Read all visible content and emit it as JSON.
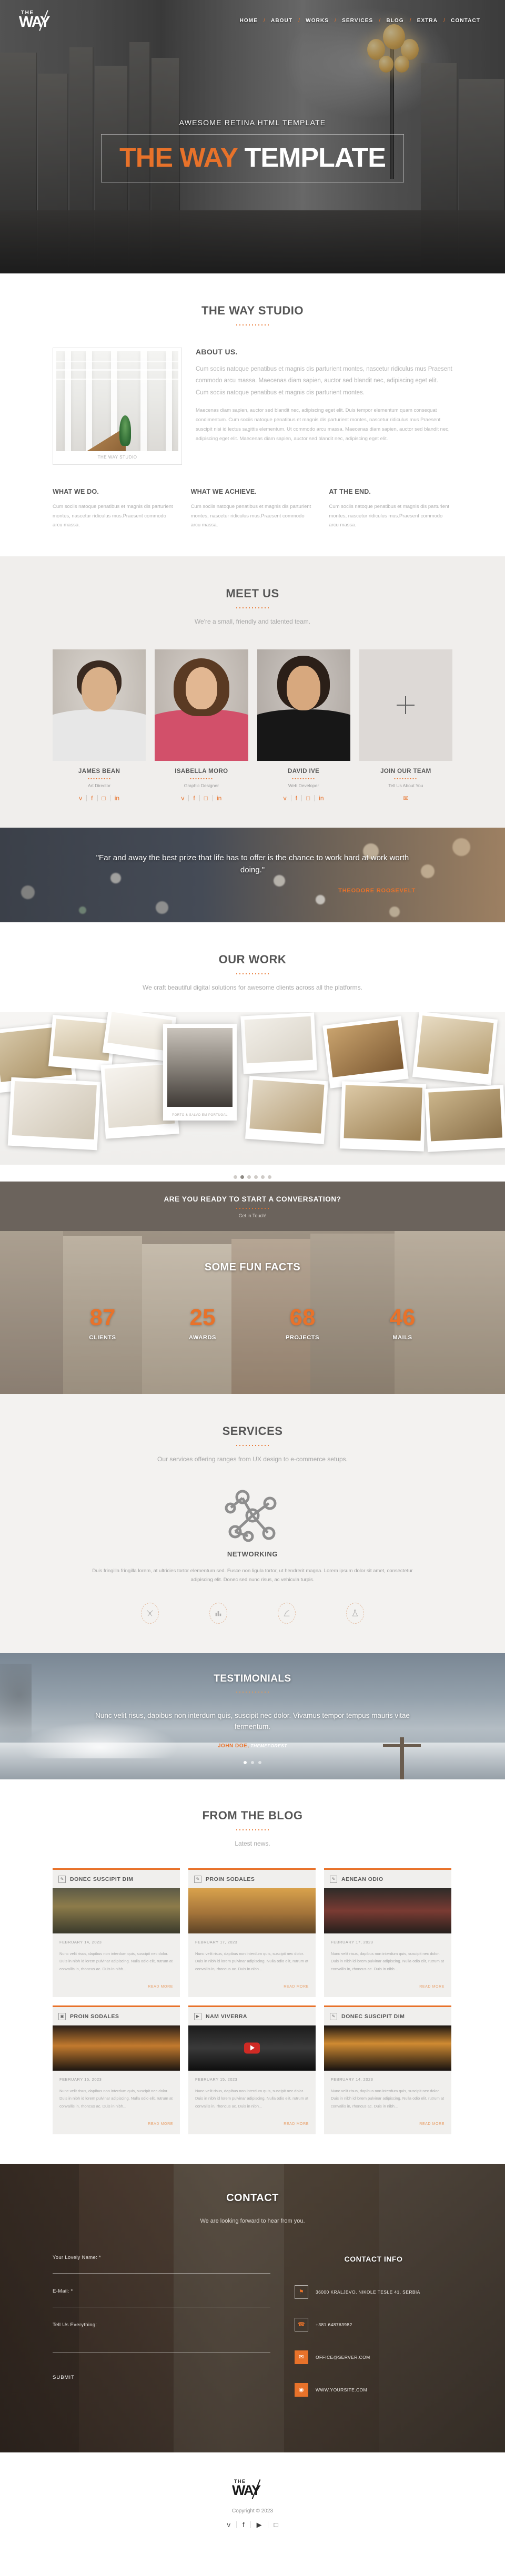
{
  "brand": {
    "the": "THE",
    "way": "WAY"
  },
  "nav": {
    "items": [
      "HOME",
      "ABOUT",
      "WORKS",
      "SERVICES",
      "BLOG",
      "EXTRA",
      "CONTACT"
    ],
    "separator": "/"
  },
  "hero": {
    "subtitle": "AWESOME RETINA HTML TEMPLATE",
    "title_orange": "THE WAY",
    "title_white": "TEMPLATE"
  },
  "studio": {
    "title": "THE WAY STUDIO",
    "about_heading": "ABOUT US.",
    "about_p1": "Cum sociis natoque penatibus et magnis dis parturient montes, nascetur ridiculus mus Praesent commodo arcu massa. Maecenas diam sapien, auctor sed blandit nec, adipiscing eget elit. Cum sociis natoque penatibus et magnis dis parturient montes.",
    "about_p2": "Maecenas diam sapien, auctor sed blandit nec, adipiscing eget elit. Duis tempor elementum quam consequat condimentum. Cum sociis natoque penatibus et magnis dis parturient montes, nascetur ridiculus mus Praesent suscipit nisi id lectus sagittis elementum. Ut commodo arcu massa. Maecenas diam sapien, auctor sed blandit nec, adipiscing eget elit. Maecenas diam sapien, auctor sed blandit nec, adipiscing eget elit.",
    "image_caption": "THE WAY STUDIO",
    "columns": [
      {
        "heading": "WHAT WE DO.",
        "text": "Cum sociis natoque penatibus et magnis dis parturient montes, nascetur ridiculus mus.Praesent commodo arcu massa."
      },
      {
        "heading": "WHAT WE ACHIEVE.",
        "text": "Cum sociis natoque penatibus et magnis dis parturient montes, nascetur ridiculus mus.Praesent commodo arcu massa."
      },
      {
        "heading": "AT THE END.",
        "text": "Cum sociis natoque penatibus et magnis dis parturient montes, nascetur ridiculus mus.Praesent commodo arcu massa."
      }
    ]
  },
  "team": {
    "title": "MEET US",
    "subtitle": "We're a small, friendly and talented team.",
    "members": [
      {
        "name": "JAMES BEAN",
        "role": "Art Director"
      },
      {
        "name": "ISABELLA MORO",
        "role": "Graphic Designer"
      },
      {
        "name": "DAVID IVE",
        "role": "Web Developer"
      },
      {
        "name": "JOIN OUR TEAM",
        "role": "Tell Us About You"
      }
    ],
    "social_icons": [
      "twitter-icon",
      "facebook-icon",
      "instagram-icon",
      "linkedin-icon"
    ],
    "social_glyphs": [
      "ᴠ",
      "f",
      "□",
      "in"
    ],
    "join_icon": "envelope-icon"
  },
  "quote": {
    "text": "\"Far and away the best prize that life has to offer is the chance to work hard at work worth doing.\"",
    "author": "THEODORE ROOSEVELT"
  },
  "work": {
    "title": "OUR WORK",
    "subtitle": "We craft beautiful digital solutions for awesome clients across all the platforms.",
    "featured_caption": "PORTO & SALVO EM PORTUGAL",
    "pager_count": 6,
    "pager_active": 1
  },
  "cta": {
    "heading": "ARE YOU READY TO START A CONVERSATION?",
    "sub": "Get in Touch!"
  },
  "facts": {
    "title": "SOME FUN FACTS",
    "items": [
      {
        "value": "87",
        "label": "CLIENTS"
      },
      {
        "value": "25",
        "label": "AWARDS"
      },
      {
        "value": "68",
        "label": "PROJECTS"
      },
      {
        "value": "46",
        "label": "MAILS"
      }
    ]
  },
  "services": {
    "title": "SERVICES",
    "subtitle": "Our services offering ranges from UX design to e-commerce setups.",
    "main_icon": "network-nodes-icon",
    "main_heading": "NETWORKING",
    "main_text": "Duis fringilla fringilla lorem, at ultricies tortor elementum sed. Fusce non ligula tortor, ut hendrerit magna. Lorem ipsum dolor sit amet, consectetur adipiscing elit. Donec sed nunc risus, ac vehicula turpis.",
    "icons": [
      "tools-icon",
      "bar-chart-icon",
      "pen-nib-icon",
      "flask-icon"
    ]
  },
  "testimonials": {
    "title": "TESTIMONIALS",
    "quote": "Nunc velit risus, dapibus non interdum quis, suscipit nec dolor. Vivamus tempor tempus mauris vitae fermentum.",
    "author": "JOHN DOE,",
    "company": "THEMEFOREST",
    "pager_count": 3,
    "pager_active": 0
  },
  "blog": {
    "title": "FROM THE BLOG",
    "subtitle": "Latest news.",
    "read_more": "READ MORE",
    "posts": [
      {
        "icon": "pencil-icon",
        "title": "DONEC SUSCIPIT DIM",
        "date": "FEBRUARY 14, 2023",
        "excerpt": "Nunc velit risus, dapibus non interdum quis, suscipit nec dolor. Duis in nibh id lorem pulvinar adipiscing. Nulla odio elit, rutrum at convallis in, rhoncus ac. Duis in nibh..."
      },
      {
        "icon": "pencil-icon",
        "title": "PROIN SODALES",
        "date": "FEBRUARY 17, 2023",
        "excerpt": "Nunc velit risus, dapibus non interdum quis, suscipit nec dolor. Duis in nibh id lorem pulvinar adipiscing. Nulla odio elit, rutrum at convallis in, rhoncus ac. Duis in nibh..."
      },
      {
        "icon": "pencil-icon",
        "title": "AENEAN ODIO",
        "date": "FEBRUARY 17, 2023",
        "excerpt": "Nunc velit risus, dapibus non interdum quis, suscipit nec dolor. Duis in nibh id lorem pulvinar adipiscing. Nulla odio elit, rutrum at convallis in, rhoncus ac. Duis in nibh..."
      },
      {
        "icon": "gallery-icon",
        "title": "PROIN SODALES",
        "date": "FEBRUARY 15, 2023",
        "excerpt": "Nunc velit risus, dapibus non interdum quis, suscipit nec dolor. Duis in nibh id lorem pulvinar adipiscing. Nulla odio elit, rutrum at convallis in, rhoncus ac. Duis in nibh..."
      },
      {
        "icon": "video-icon",
        "title": "NAM VIVERRA",
        "date": "FEBRUARY 15, 2023",
        "excerpt": "Nunc velit risus, dapibus non interdum quis, suscipit nec dolor. Duis in nibh id lorem pulvinar adipiscing. Nulla odio elit, rutrum at convallis in, rhoncus ac. Duis in nibh..."
      },
      {
        "icon": "pencil-icon",
        "title": "DONEC SUSCIPIT DIM",
        "date": "FEBRUARY 14, 2023",
        "excerpt": "Nunc velit risus, dapibus non interdum quis, suscipit nec dolor. Duis in nibh id lorem pulvinar adipiscing. Nulla odio elit, rutrum at convallis in, rhoncus ac. Duis in nibh..."
      }
    ]
  },
  "contact": {
    "title": "CONTACT",
    "subtitle": "We are looking forward to hear from you.",
    "fields": [
      {
        "label": "Your Lovely Name: *",
        "placeholder": ""
      },
      {
        "label": "E-Mail: *",
        "placeholder": ""
      },
      {
        "label": "Tell Us Everything:",
        "placeholder": ""
      }
    ],
    "submit": "SUBMIT",
    "info_title": "CONTACT INFO",
    "info": [
      {
        "icon": "map-pin-icon",
        "text": "36000 KRALJEVO, NIKOLE TESLE 41, SERBIA"
      },
      {
        "icon": "phone-icon",
        "text": "+381 648763982"
      },
      {
        "icon": "envelope-icon",
        "text": "OFFICE@SERVER.COM"
      },
      {
        "icon": "globe-icon",
        "text": "WWW.YOURSITE.COM"
      }
    ]
  },
  "footer": {
    "copyright": "Copyright © 2023",
    "social_icons": [
      "twitter-icon",
      "facebook-icon",
      "youtube-icon",
      "instagram-icon"
    ],
    "social_glyphs": [
      "ᴠ",
      "f",
      "▶",
      "□"
    ]
  },
  "colors": {
    "accent": "#e8722a",
    "dark": "#555555",
    "muted": "#a9a9a9",
    "band": "#6b635c"
  }
}
